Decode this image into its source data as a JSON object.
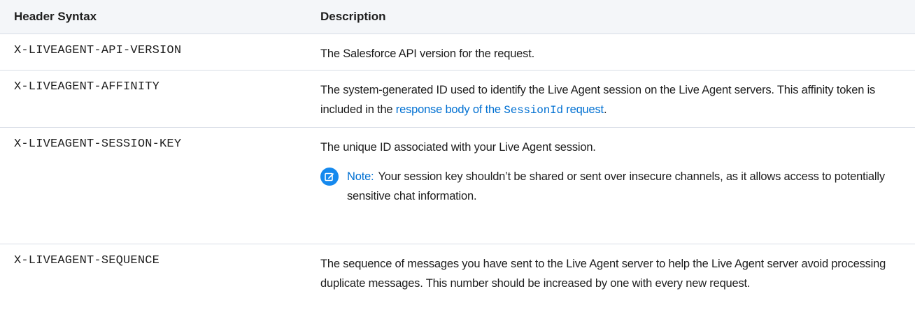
{
  "table": {
    "headers": {
      "syntax": "Header Syntax",
      "description": "Description"
    },
    "rows": [
      {
        "syntax": "X-LIVEAGENT-API-VERSION",
        "description": "The Salesforce API version for the request."
      },
      {
        "syntax": "X-LIVEAGENT-AFFINITY",
        "description_before_link": "The system-generated ID used to identify the Live Agent session on the Live Agent servers. This affinity token is included in the ",
        "link_text_before_code": "response body of the ",
        "link_code": "SessionId",
        "link_text_after_code": " request",
        "description_after_link": "."
      },
      {
        "syntax": "X-LIVEAGENT-SESSION-KEY",
        "description": "The unique ID associated with your Live Agent session.",
        "note": {
          "label": "Note:",
          "text": "Your session key shouldn’t be shared or sent over insecure channels, as it allows access to potentially sensitive chat information.",
          "icon": "note-edit-icon"
        }
      },
      {
        "syntax": "X-LIVEAGENT-SEQUENCE",
        "description": "The sequence of messages you have sent to the Live Agent server to help the Live Agent server avoid processing duplicate messages. This number should be increased by one with every new request."
      }
    ]
  },
  "colors": {
    "header_bg": "#f4f6f9",
    "border": "#d8dde6",
    "link": "#0070d2",
    "note_icon_bg": "#1589ee"
  }
}
